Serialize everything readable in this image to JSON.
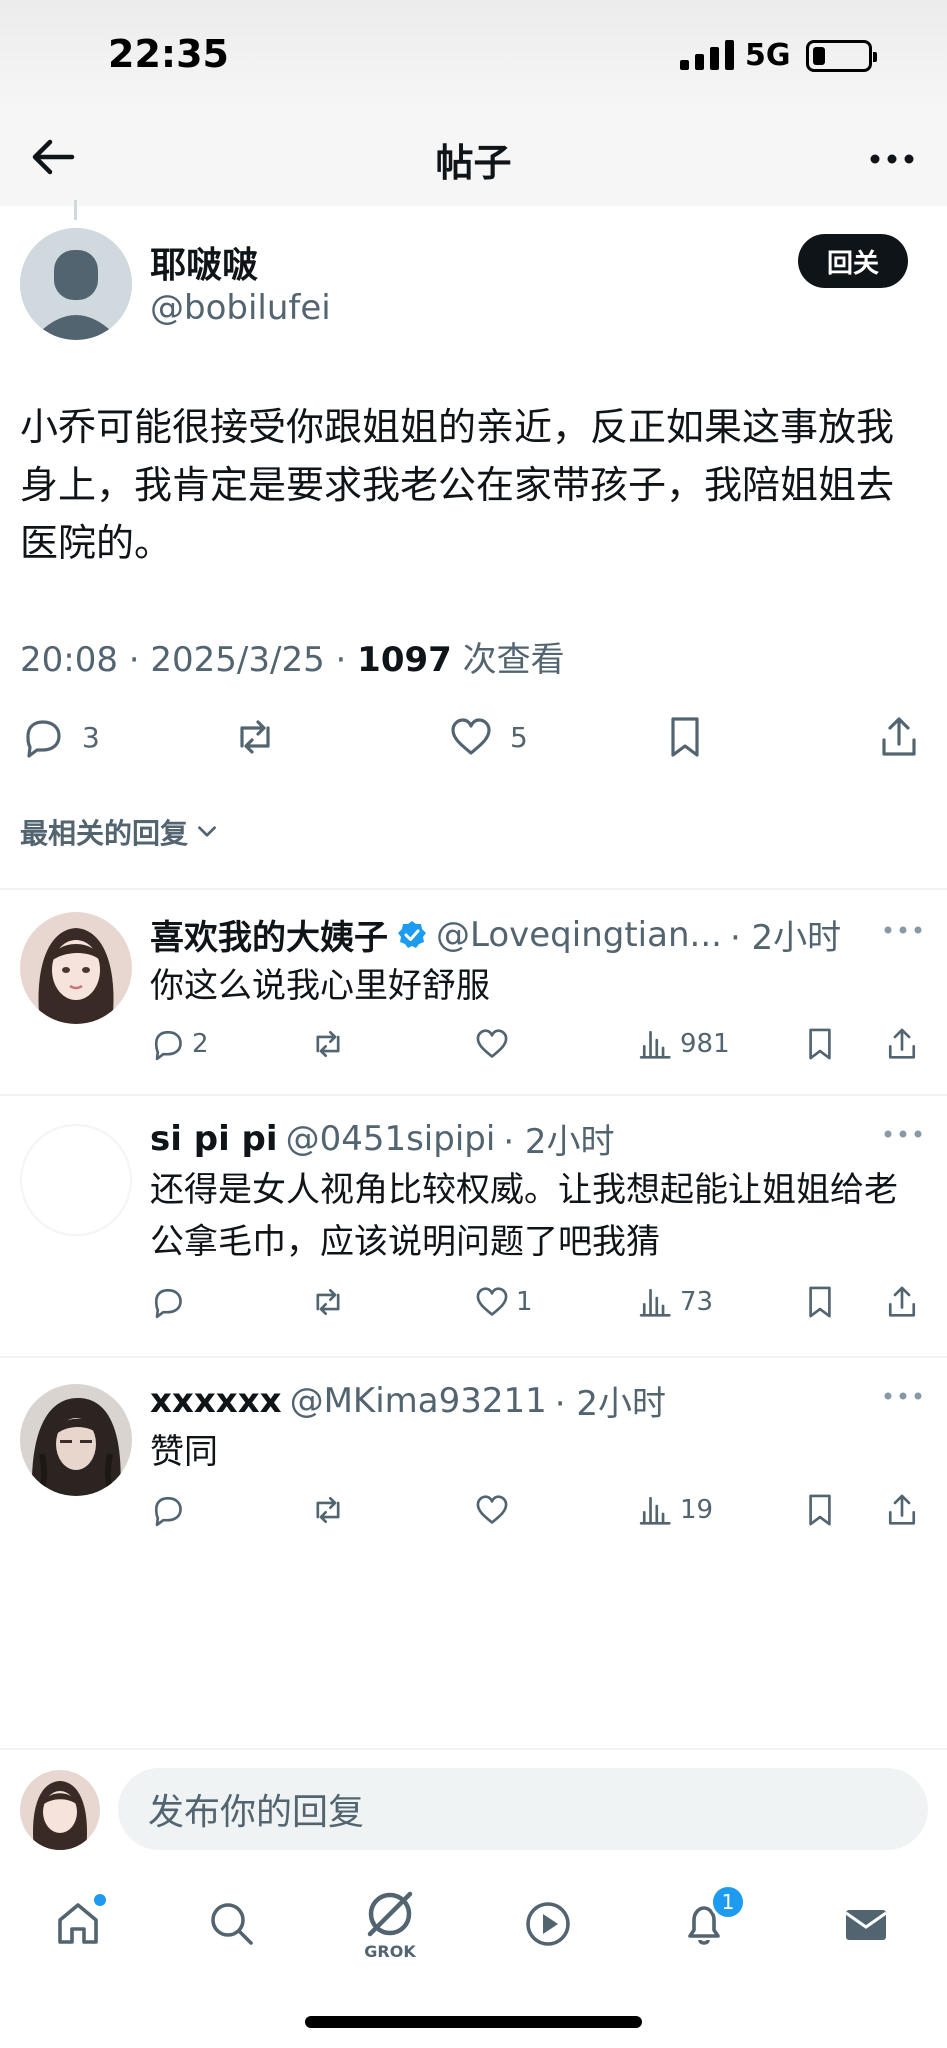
{
  "status_bar": {
    "time": "22:35",
    "network": "5G"
  },
  "header": {
    "title": "帖子"
  },
  "post": {
    "author_name": "耶啵啵",
    "author_handle": "@bobilufei",
    "follow_button": "回关",
    "text": "小乔可能很接受你跟姐姐的亲近，反正如果这事放我身上，我肯定是要求我老公在家带孩子，我陪姐姐去医院的。",
    "time": "20:08 · 2025/3/25 · ",
    "views": "1097",
    "views_label": " 次查看",
    "reply_count": "3",
    "like_count": "5"
  },
  "sort": {
    "label": "最相关的回复"
  },
  "replies": [
    {
      "name": "喜欢我的大姨子",
      "verified": true,
      "handle": "@Loveqingtian...",
      "time": "· 2小时",
      "text": "你这么说我心里好舒服",
      "reply_count": "2",
      "retweet_count": "",
      "like_count": "",
      "views": "981"
    },
    {
      "name": "si pi pi",
      "verified": false,
      "handle": "@0451sipipi",
      "time": "· 2小时",
      "text": "还得是女人视角比较权威。让我想起能让姐姐给老公拿毛巾，应该说明问题了吧我猜",
      "reply_count": "",
      "retweet_count": "",
      "like_count": "1",
      "views": "73"
    },
    {
      "name": "xxxxxx",
      "verified": false,
      "handle": "@MKima93211",
      "time": "· 2小时",
      "text": "赞同",
      "reply_count": "",
      "retweet_count": "",
      "like_count": "",
      "views": "19"
    }
  ],
  "compose": {
    "placeholder": "发布你的回复"
  },
  "tabbar": {
    "grok_label": "GROK",
    "notification_count": "1"
  },
  "colors": {
    "accent": "#1d9bf0",
    "text": "#0f1419",
    "muted": "#536471"
  }
}
